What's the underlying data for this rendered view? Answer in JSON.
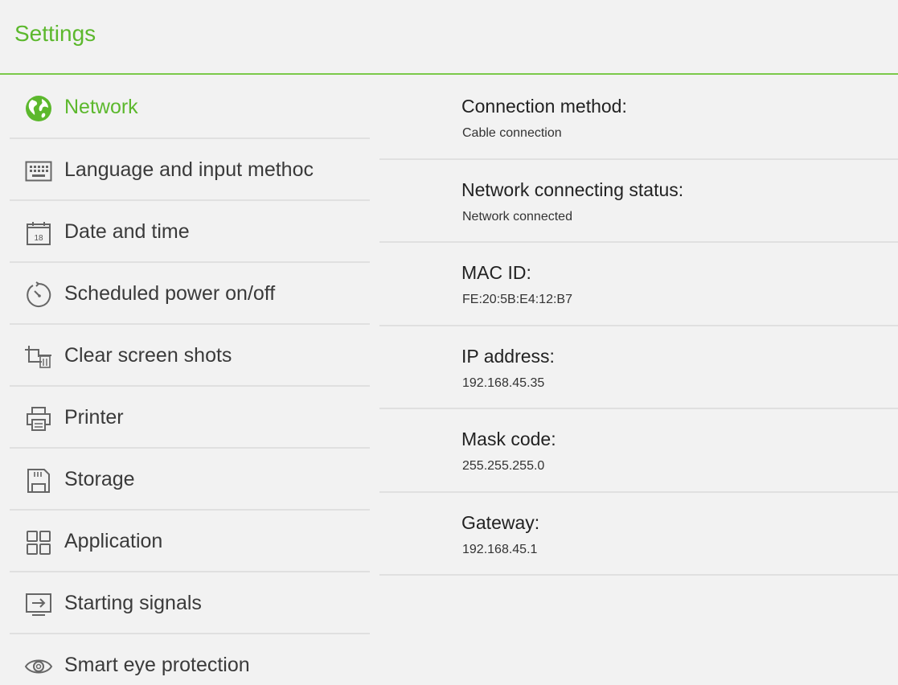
{
  "header": {
    "title": "Settings"
  },
  "accent_color": "#5cb82d",
  "sidebar": {
    "items": [
      {
        "label": "Network",
        "icon": "globe-icon",
        "active": true
      },
      {
        "label": "Language and input methoc",
        "icon": "keyboard-icon",
        "active": false
      },
      {
        "label": "Date and time",
        "icon": "calendar-icon",
        "active": false,
        "icon_text": "18"
      },
      {
        "label": "Scheduled power on/off",
        "icon": "timer-icon",
        "active": false
      },
      {
        "label": "Clear screen shots",
        "icon": "crop-trash-icon",
        "active": false
      },
      {
        "label": "Printer",
        "icon": "printer-icon",
        "active": false
      },
      {
        "label": "Storage",
        "icon": "sd-card-icon",
        "active": false
      },
      {
        "label": "Application",
        "icon": "apps-grid-icon",
        "active": false
      },
      {
        "label": "Starting signals",
        "icon": "input-signal-icon",
        "active": false
      },
      {
        "label": "Smart eye protection",
        "icon": "eye-icon",
        "active": false
      }
    ]
  },
  "network_details": [
    {
      "label": "Connection method:",
      "value": "Cable connection"
    },
    {
      "label": "Network connecting status:",
      "value": "Network connected"
    },
    {
      "label": "MAC ID:",
      "value": "FE:20:5B:E4:12:B7"
    },
    {
      "label": "IP address:",
      "value": "192.168.45.35"
    },
    {
      "label": "Mask code:",
      "value": "255.255.255.0"
    },
    {
      "label": "Gateway:",
      "value": "192.168.45.1"
    }
  ]
}
